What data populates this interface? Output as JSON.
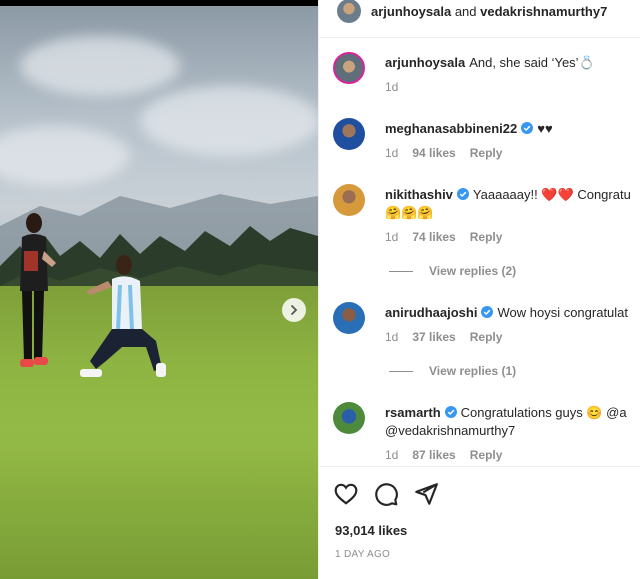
{
  "header": {
    "username": "arjunhoysala",
    "joiner": "and",
    "coauthor": "vedakrishnamurthy7"
  },
  "caption": {
    "username": "arjunhoysala",
    "text": "And, she said ‘Yes’💍",
    "time": "1d"
  },
  "comments": [
    {
      "username": "meghanasabbineni22",
      "verified": true,
      "text": "♥♥",
      "time": "1d",
      "likes": "94 likes",
      "reply": "Reply"
    },
    {
      "username": "nikithashiv",
      "verified": true,
      "text": "Yaaaaaay!! ❤️❤️ Congratu",
      "text2": "🤗🤗🤗",
      "time": "1d",
      "likes": "74 likes",
      "reply": "Reply",
      "view_replies": "View replies (2)"
    },
    {
      "username": "anirudhaajoshi",
      "verified": true,
      "text": "Wow hoysi congratulat",
      "time": "1d",
      "likes": "37 likes",
      "reply": "Reply",
      "view_replies": "View replies (1)"
    },
    {
      "username": "rsamarth",
      "verified": true,
      "text": "Congratulations guys 😊 @a",
      "text2": "@vedakrishnamurthy7",
      "time": "1d",
      "likes": "87 likes",
      "reply": "Reply"
    }
  ],
  "post": {
    "likes": "93,014 likes",
    "date": "1 DAY AGO"
  },
  "icons": {
    "like": "heart-icon",
    "comment": "comment-icon",
    "share": "share-icon",
    "next": "chevron-right-icon"
  },
  "colors": {
    "verified": "#3897f0",
    "heart": "#ed4956",
    "meta": "#8e8e8e"
  }
}
